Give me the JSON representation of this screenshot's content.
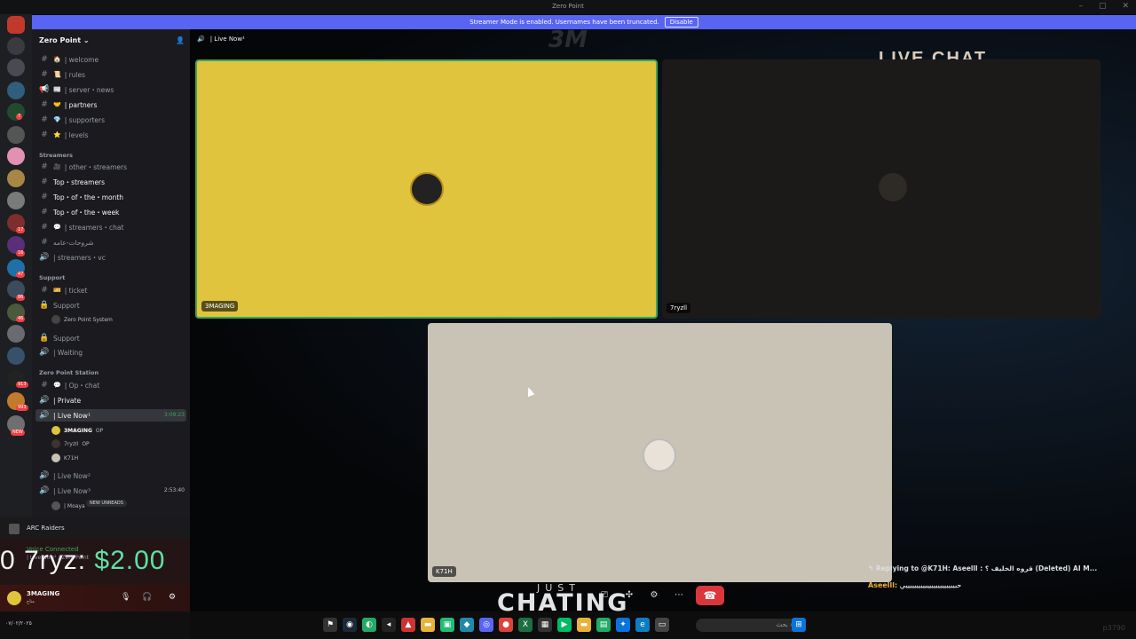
{
  "window": {
    "title": "Zero Point",
    "controls": [
      "–",
      "▢",
      "✕"
    ]
  },
  "banner": {
    "text": "Streamer Mode is enabled. Usernames have been truncated.",
    "button": "Disable"
  },
  "rail": {
    "badges": [
      "7",
      "17",
      "16",
      "47",
      "86",
      "46",
      "913",
      "993",
      "NEW"
    ]
  },
  "server": {
    "name": "Zero Point",
    "chevron": "⌄"
  },
  "channels": [
    {
      "sym": "#",
      "emoji": "🏠",
      "label": "| welcome"
    },
    {
      "sym": "#",
      "emoji": "📜",
      "label": "| rules"
    },
    {
      "sym": "📢",
      "emoji": "📰",
      "label": "| server・news"
    },
    {
      "sym": "#",
      "emoji": "🤝",
      "label": "| partners"
    },
    {
      "sym": "#",
      "emoji": "💎",
      "label": "| supporters"
    },
    {
      "sym": "#",
      "emoji": "⭐",
      "label": "| levels"
    }
  ],
  "streamers_category": "Streamers",
  "streamer_channels": [
    {
      "sym": "#",
      "emoji": "🎥",
      "label": "| other・streamers"
    },
    {
      "sym": "#",
      "emoji": "",
      "label": "Top・streamers"
    },
    {
      "sym": "#",
      "emoji": "",
      "label": "Top・of・the・month"
    },
    {
      "sym": "#",
      "emoji": "",
      "label": "Top・of・the・week"
    },
    {
      "sym": "#",
      "emoji": "💬",
      "label": "| streamers・chat"
    },
    {
      "sym": "#",
      "emoji": "",
      "label": "شروحات-عامه"
    },
    {
      "sym": "🔊",
      "emoji": "",
      "label": "| streamers・vc"
    }
  ],
  "support_category": "Support",
  "support_channels": [
    {
      "sym": "#",
      "emoji": "🎫",
      "label": "| ticket"
    },
    {
      "sym": "🔒",
      "emoji": "",
      "label": "Support"
    }
  ],
  "support_user": "Zero Point System",
  "support_channels2": [
    {
      "sym": "🔒",
      "label": "Support"
    },
    {
      "sym": "🔊",
      "label": "| Waiting"
    }
  ],
  "station_category": "Zero Point Station",
  "station_channels": [
    {
      "sym": "#",
      "emoji": "💬",
      "label": "| Op・chat"
    },
    {
      "sym": "🔊",
      "emoji": "",
      "label": "| Private"
    }
  ],
  "active_channel": {
    "label": "| Live Now¹",
    "time": "3:09:23"
  },
  "voice_users": [
    {
      "name": "3MAGING",
      "tag": "OP"
    },
    {
      "name": "7ryzاا",
      "tag": "OP"
    },
    {
      "name": "K71H",
      "tag": ""
    }
  ],
  "live_channels": [
    {
      "label": "| Live Now²",
      "time": ""
    },
    {
      "label": "| Live Now³",
      "time": "2:53:40"
    }
  ],
  "moaya": {
    "name": "| Moaya",
    "badge": "NEW UNREADS"
  },
  "arc": {
    "label": "ARC Raiders"
  },
  "voice": {
    "status": "Voice Connected",
    "channel": "| Live Now¹ / Zero Point"
  },
  "user": {
    "name": "3MAGING",
    "status": "متاح"
  },
  "donation": {
    "prefix": "0",
    "name": "7ryz:",
    "amount": "$2.00"
  },
  "stage": {
    "header": "| Live Now¹",
    "tiles": [
      {
        "name": "3MAGING",
        "bg": "#e0c43e"
      },
      {
        "name": "7ryzاا",
        "bg": "#1c1a18"
      },
      {
        "name": "K71H",
        "bg": "#c9c3b6"
      }
    ]
  },
  "overlay": {
    "logo": "3M",
    "livechat": "LIVE CHAT",
    "just": "JUST",
    "chating": "CHATING"
  },
  "chat": {
    "reply": "↰ Replying to @K71H: Aseelll : قروه الخليف ؟ (Deleted) AI M...",
    "user": "Aseelll:",
    "message": "حبيبيييييييييييييييييييييي"
  },
  "taskbar": {
    "search": "بحث",
    "corner": "p3790",
    "clock": "٠٧/٠٢/٢٠٢٥"
  },
  "colors": {
    "accent": "#5865f2",
    "end_call": "#da373c",
    "donation": "#5fe0a4",
    "chat_user": "#f0b232"
  }
}
